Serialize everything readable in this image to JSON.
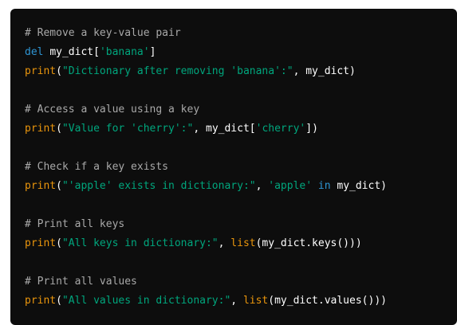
{
  "code": {
    "lines": [
      {
        "comment": "# Remove a key-value pair"
      },
      {
        "kw": "del",
        "sp": " ",
        "var": "my_dict[",
        "str": "'banana'",
        "close": "]"
      },
      {
        "fn": "print",
        "open": "(",
        "str": "\"Dictionary after removing 'banana':\"",
        "mid": ", my_dict)"
      },
      {
        "blank": ""
      },
      {
        "comment": "# Access a value using a key"
      },
      {
        "fn": "print",
        "open": "(",
        "str": "\"Value for 'cherry':\"",
        "mid": ", my_dict[",
        "str2": "'cherry'",
        "close": "])"
      },
      {
        "blank": ""
      },
      {
        "comment": "# Check if a key exists"
      },
      {
        "fn": "print",
        "open": "(",
        "str": "\"'apple' exists in dictionary:\"",
        "mid": ", ",
        "str2": "'apple'",
        "sp": " ",
        "kw": "in",
        "close": " my_dict)"
      },
      {
        "blank": ""
      },
      {
        "comment": "# Print all keys"
      },
      {
        "fn": "print",
        "open": "(",
        "str": "\"All keys in dictionary:\"",
        "mid": ", ",
        "fn2": "list",
        "close": "(my_dict.keys()))"
      },
      {
        "blank": ""
      },
      {
        "comment": "# Print all values"
      },
      {
        "fn": "print",
        "open": "(",
        "str": "\"All values in dictionary:\"",
        "mid": ", ",
        "fn2": "list",
        "close": "(my_dict.values()))"
      }
    ]
  }
}
